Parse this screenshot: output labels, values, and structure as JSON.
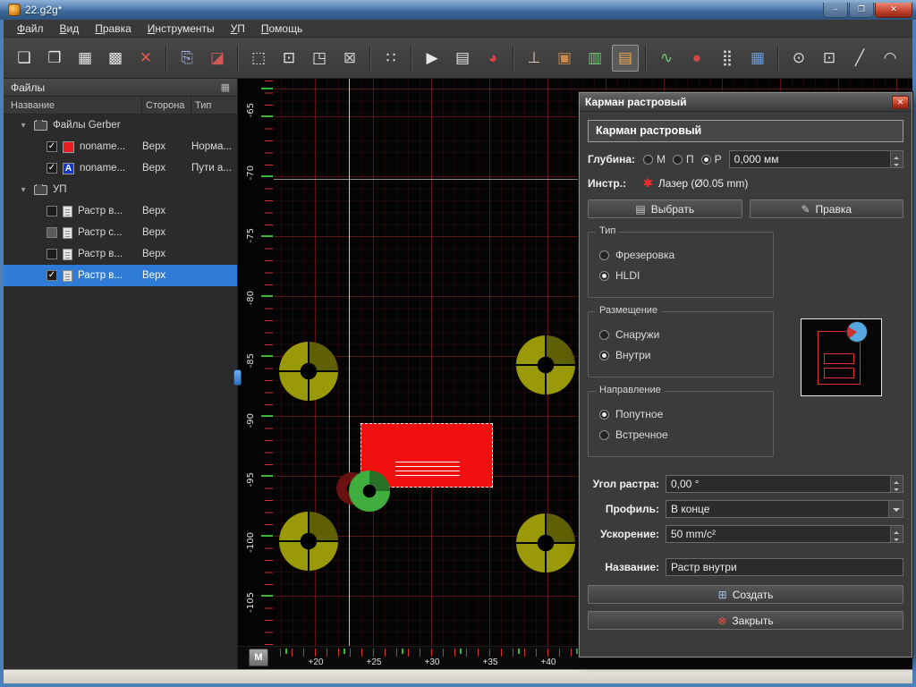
{
  "window": {
    "title": "22.g2g*",
    "minimize_glyph": "–",
    "maximize_glyph": "❐",
    "close_glyph": "✕"
  },
  "menu": {
    "items": [
      {
        "label": "Файл"
      },
      {
        "label": "Вид"
      },
      {
        "label": "Правка"
      },
      {
        "label": "Инструменты"
      },
      {
        "label": "УП"
      },
      {
        "label": "Помощь"
      }
    ]
  },
  "toolbar": {
    "icons": [
      {
        "name": "new-file",
        "glyph": "❏",
        "color": "#e6e6e6"
      },
      {
        "name": "open-file",
        "glyph": "❒",
        "color": "#e6e6e6"
      },
      {
        "name": "save-file",
        "glyph": "▦",
        "color": "#e6e6e6"
      },
      {
        "name": "save-as",
        "glyph": "▩",
        "color": "#e6e6e6"
      },
      {
        "name": "close-file",
        "glyph": "✕",
        "color": "#e25b4b"
      },
      {
        "name": "import-file",
        "glyph": "⎘",
        "color": "#9fb6e4"
      },
      {
        "name": "layers-compare",
        "glyph": "◪",
        "color": "#d05858"
      },
      {
        "name": "zoom-window",
        "glyph": "⬚",
        "color": "#e6e6e6"
      },
      {
        "name": "zoom-fit",
        "glyph": "⊡",
        "color": "#e6e6e6"
      },
      {
        "name": "zoom-selection",
        "glyph": "◳",
        "color": "#e6e6e6"
      },
      {
        "name": "zoom-object",
        "glyph": "⊠",
        "color": "#c9c9c9"
      },
      {
        "name": "snap-grid",
        "glyph": "∷",
        "color": "#e6e6e6"
      },
      {
        "name": "run-job",
        "glyph": "▶",
        "color": "#e6e6e6"
      },
      {
        "name": "tool-table",
        "glyph": "▤",
        "color": "#e6e6e6"
      },
      {
        "name": "pie-preview",
        "glyph": "◕",
        "color": "#e04040"
      },
      {
        "name": "drill-tool",
        "glyph": "⊥",
        "color": "#e6c9a8"
      },
      {
        "name": "mill-tool",
        "glyph": "▣",
        "color": "#c98a4b"
      },
      {
        "name": "raster-green",
        "glyph": "▥",
        "color": "#79c979"
      },
      {
        "name": "raster-pocket",
        "glyph": "▤",
        "color": "#e8a94f"
      },
      {
        "name": "spline-tool",
        "glyph": "∿",
        "color": "#79c979"
      },
      {
        "name": "circle-fill-tool",
        "glyph": "●",
        "color": "#d04848"
      },
      {
        "name": "matrix-tool",
        "glyph": "⣿",
        "color": "#d9d9d9"
      },
      {
        "name": "grid-blue-tool",
        "glyph": "▦",
        "color": "#6b9bd9"
      },
      {
        "name": "circle-center-tool",
        "glyph": "⊙",
        "color": "#d9d9d9"
      },
      {
        "name": "rect-center-tool",
        "glyph": "⊡",
        "color": "#d9d9d9"
      },
      {
        "name": "line-tool",
        "glyph": "╱",
        "color": "#d9d9d9"
      },
      {
        "name": "arc-tool",
        "glyph": "◠",
        "color": "#d9d9d9"
      }
    ]
  },
  "files_panel": {
    "title": "Файлы",
    "menu_icon": "▦",
    "columns": {
      "name": "Название",
      "side": "Сторона",
      "type": "Тип"
    },
    "groups": [
      {
        "arrow": "▾",
        "label": "Файлы Gerber"
      },
      {
        "arrow": "▾",
        "label": "УП"
      }
    ],
    "gerber_rows": [
      {
        "check": "✓",
        "name": "noname...",
        "side": "Верх",
        "type": "Норма..."
      },
      {
        "check": "✓",
        "icon_letter": "A",
        "name": "noname...",
        "side": "Верх",
        "type": "Пути а..."
      }
    ],
    "up_rows": [
      {
        "check": "",
        "name": "Растр в...",
        "side": "Верх"
      },
      {
        "check": "",
        "name": "Растр с...",
        "side": "Верх"
      },
      {
        "check": "",
        "name": "Растр в...",
        "side": "Верх"
      },
      {
        "check": "✓",
        "name": "Растр в...",
        "side": "Верх"
      }
    ]
  },
  "canvas": {
    "v_ruler": [
      "-65",
      "-70",
      "-75",
      "-80",
      "-85",
      "-90",
      "-95",
      "-100",
      "-105"
    ],
    "h_ruler": [
      "+20",
      "+25",
      "+30",
      "+35",
      "+40"
    ],
    "m_button": "M"
  },
  "dialog": {
    "title": "Карман растровый",
    "close_glyph": "✕",
    "header": "Карман растровый",
    "depth_label": "Глубина:",
    "depth_m": "М",
    "depth_p": "П",
    "depth_r": "Р",
    "depth_value": "0,000 мм",
    "tool_label": "Инстр.:",
    "tool_icon": "✱",
    "tool_value": "Лазер (Ø0.05 mm)",
    "select_icon": "▤",
    "select_label": "Выбрать",
    "edit_icon": "✎",
    "edit_label": "Правка",
    "type_label": "Тип",
    "type_opt1": "Фрезеровка",
    "type_opt2": "HLDI",
    "placement_label": "Размещение",
    "placement_opt1": "Снаружи",
    "placement_opt2": "Внутри",
    "direction_label": "Направление",
    "direction_opt1": "Попутное",
    "direction_opt2": "Встречное",
    "angle_label": "Угол растра:",
    "angle_value": "0,00 °",
    "profile_label": "Профиль:",
    "profile_value": "В конце",
    "accel_label": "Ускорение:",
    "accel_value": "50 mm/c²",
    "name_label": "Название:",
    "name_value": "Растр внутри",
    "create_icon": "⊞",
    "create_label": "Создать",
    "closebtn_icon": "⊗",
    "closebtn_label": "Закрыть"
  },
  "colors": {
    "selection_blue": "#2e7cd6",
    "grid_red": "#c82828",
    "donut_yellow": "#9a9a08",
    "pocket_red": "#f01010",
    "accent_green": "#3fae3f"
  }
}
